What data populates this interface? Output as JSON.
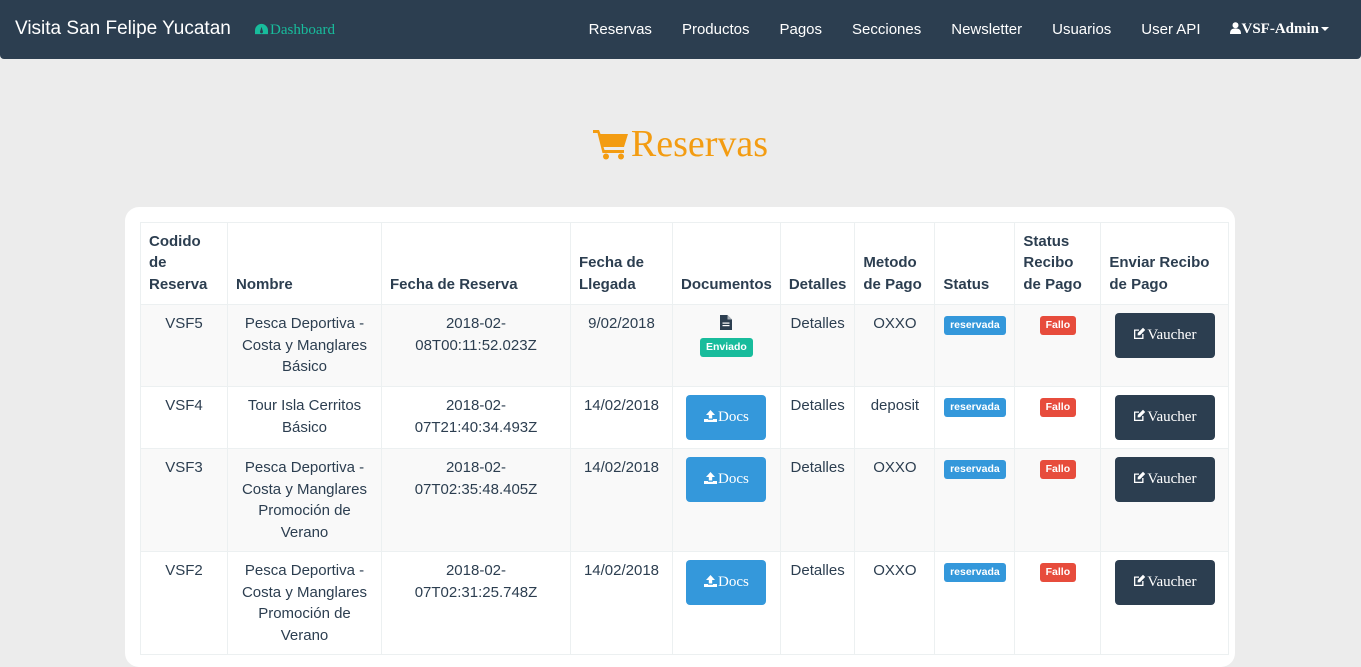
{
  "navbar": {
    "brand": "Visita San Felipe Yucatan",
    "dashboard": "Dashboard",
    "links": [
      "Reservas",
      "Productos",
      "Pagos",
      "Secciones",
      "Newsletter",
      "Usuarios",
      "User API"
    ],
    "user": "VSF-Admin"
  },
  "page": {
    "title": "Reservas"
  },
  "table": {
    "headers": {
      "codigo": "Codido de Reserva",
      "nombre": "Nombre",
      "fecha_reserva": "Fecha de Reserva",
      "fecha_llegada": "Fecha de Llegada",
      "documentos": "Documentos",
      "detalles": "Detalles",
      "metodo": "Metodo de Pago",
      "status": "Status",
      "status_recibo": "Status Recibo de Pago",
      "enviar": "Enviar Recibo de Pago"
    },
    "rows": [
      {
        "codigo": "VSF5",
        "nombre": "Pesca Deportiva - Costa y Manglares Básico",
        "fecha_reserva": "2018-02-08T00:11:52.023Z",
        "fecha_llegada": "9/02/2018",
        "documentos": "Enviado",
        "detalles": "Detalles",
        "metodo": "OXXO",
        "status": "reservada",
        "status_recibo": "Fallo",
        "enviar": "Vaucher"
      },
      {
        "codigo": "VSF4",
        "nombre": "Tour Isla Cerritos Básico",
        "fecha_reserva": "2018-02-07T21:40:34.493Z",
        "fecha_llegada": "14/02/2018",
        "documentos": "Docs",
        "detalles": "Detalles",
        "metodo": "deposit",
        "status": "reservada",
        "status_recibo": "Fallo",
        "enviar": "Vaucher"
      },
      {
        "codigo": "VSF3",
        "nombre": "Pesca Deportiva - Costa y Manglares Promoción de Verano",
        "fecha_reserva": "2018-02-07T02:35:48.405Z",
        "fecha_llegada": "14/02/2018",
        "documentos": "Docs",
        "detalles": "Detalles",
        "metodo": "OXXO",
        "status": "reservada",
        "status_recibo": "Fallo",
        "enviar": "Vaucher"
      },
      {
        "codigo": "VSF2",
        "nombre": "Pesca Deportiva - Costa y Manglares Promoción de Verano",
        "fecha_reserva": "2018-02-07T02:31:25.748Z",
        "fecha_llegada": "14/02/2018",
        "documentos": "Docs",
        "detalles": "Detalles",
        "metodo": "OXXO",
        "status": "reservada",
        "status_recibo": "Fallo",
        "enviar": "Vaucher"
      }
    ]
  },
  "colors": {
    "navbar": "#2c3e50",
    "accent": "#18bc9c",
    "title": "#f39c12",
    "info": "#3498db",
    "danger": "#e74c3c"
  },
  "icons": {
    "dashboard": "dashboard-icon",
    "user": "user-icon",
    "cart": "cart-icon",
    "file": "file-icon",
    "upload": "upload-icon",
    "edit": "edit-icon"
  }
}
